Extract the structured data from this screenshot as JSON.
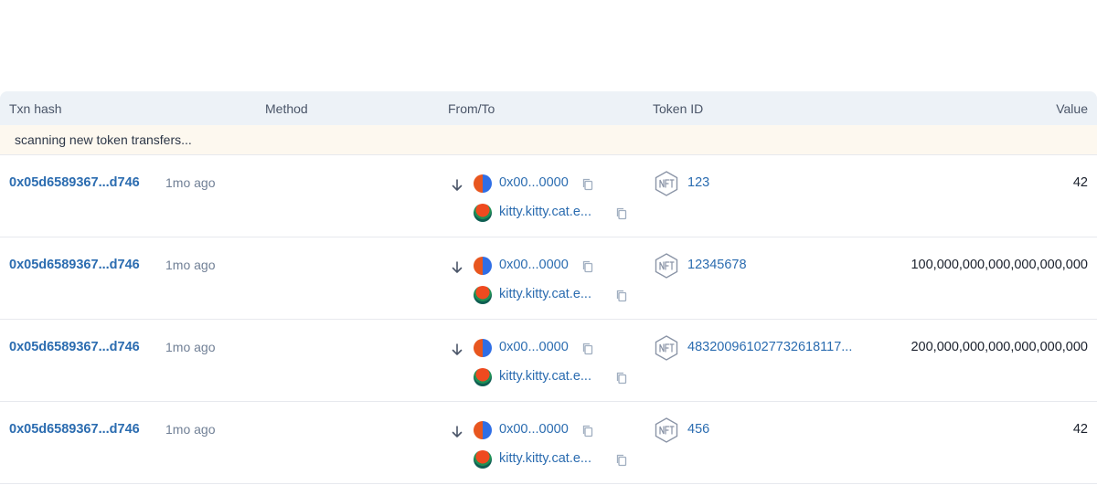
{
  "table": {
    "headers": {
      "txn_hash": "Txn hash",
      "method": "Method",
      "from_to": "From/To",
      "token_id": "Token ID",
      "value": "Value"
    },
    "banner": "scanning new token transfers...",
    "rows": [
      {
        "hash": "0x05d6589367...d746",
        "age": "1mo ago",
        "from": "0x00...0000",
        "to": "kitty.kitty.cat.e...",
        "token_id": "123",
        "value": "42"
      },
      {
        "hash": "0x05d6589367...d746",
        "age": "1mo ago",
        "from": "0x00...0000",
        "to": "kitty.kitty.cat.e...",
        "token_id": "12345678",
        "value": "100,000,000,000,000,000,000"
      },
      {
        "hash": "0x05d6589367...d746",
        "age": "1mo ago",
        "from": "0x00...0000",
        "to": "kitty.kitty.cat.e...",
        "token_id": "483200961027732618117...",
        "value": "200,000,000,000,000,000,000"
      },
      {
        "hash": "0x05d6589367...d746",
        "age": "1mo ago",
        "from": "0x00...0000",
        "to": "kitty.kitty.cat.e...",
        "token_id": "456",
        "value": "42"
      }
    ]
  },
  "icons": {
    "direction": "arrow-down-icon",
    "copy": "copy-icon",
    "token": "nft-icon"
  },
  "colors": {
    "link": "#2b6cb0",
    "header_bg": "#edf2f7",
    "banner_bg": "#fdf8ef",
    "muted_text": "#718096"
  }
}
